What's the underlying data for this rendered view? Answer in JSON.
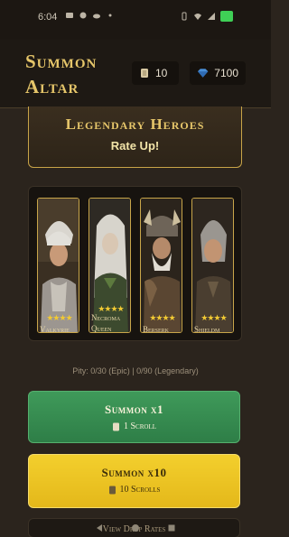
{
  "status_bar": {
    "time": "6:04"
  },
  "header": {
    "title": "Summon Altar",
    "scrolls_count": "10",
    "gems_count": "7100"
  },
  "banner": {
    "title": "Legendary Heroes",
    "subtitle": "Rate Up!"
  },
  "heroes": [
    {
      "name": "Valkyrie",
      "stars": "★★★★"
    },
    {
      "name": "Necromancer Queen",
      "stars": "★★★★"
    },
    {
      "name": "Berserker",
      "stars": "★★★★"
    },
    {
      "name": "Shieldmaiden",
      "stars": "★★★★"
    }
  ],
  "hero_name_display": [
    "Valkyrie",
    "Necroma",
    "Queen",
    "Berserk",
    "Shieldm"
  ],
  "pity_text": "Pity: 0/30 (Epic) | 0/90 (Legendary)",
  "summon_x1": {
    "label": "Summon x1",
    "cost": "1 Scroll"
  },
  "summon_x10": {
    "label": "Summon x10",
    "cost": "10 Scrolls"
  },
  "drop_rates_label": "View Drop Rates",
  "colors": {
    "gold_accent": "#e6c66a",
    "green_button": "#3f9a5a",
    "yellow_button": "#f3cf2d",
    "background": "#2b241d"
  }
}
